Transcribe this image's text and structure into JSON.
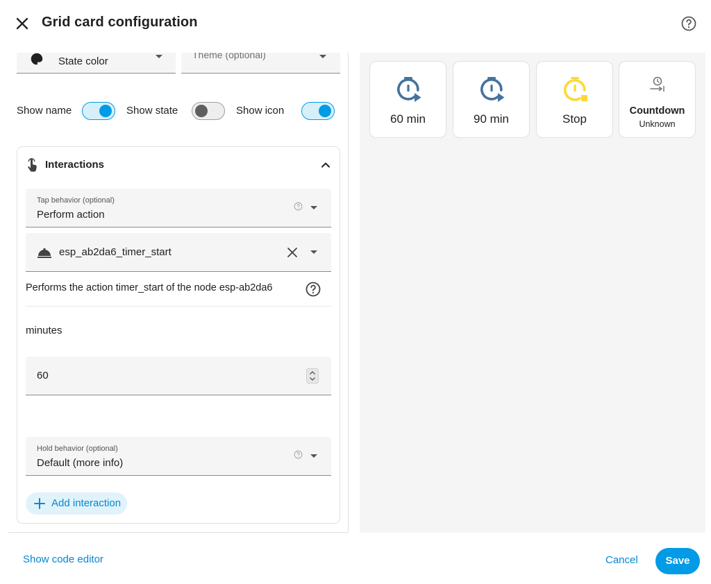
{
  "dialog": {
    "title": "Grid card configuration",
    "close_icon": "close-icon",
    "help_icon": "help-circle-icon"
  },
  "editor": {
    "state_color_label": "State color",
    "theme_placeholder": "Theme (optional)",
    "toggles": [
      {
        "label": "Show name",
        "on": true
      },
      {
        "label": "Show state",
        "on": false
      },
      {
        "label": "Show icon",
        "on": true
      }
    ],
    "interactions": {
      "title": "Interactions",
      "tap_label": "Tap behavior (optional)",
      "tap_value": "Perform action",
      "action_value": "esp_ab2da6_timer_start",
      "description": "Performs the action timer_start of the node esp-ab2da6",
      "minutes_label": "minutes",
      "minutes_value": "60",
      "hold_label": "Hold behavior (optional)",
      "hold_value": "Default (more info)",
      "add_label": "Add interaction"
    }
  },
  "preview": {
    "tiles": [
      {
        "name": "60 min",
        "icon": "timer-play-icon",
        "color": "#44739e"
      },
      {
        "name": "90 min",
        "icon": "timer-play-icon",
        "color": "#44739e"
      },
      {
        "name": "Stop",
        "icon": "timer-stop-icon",
        "color": "#fdd835"
      },
      {
        "name": "Countdown",
        "state": "Unknown",
        "icon": "timer-countdown-icon",
        "color": "#757575"
      }
    ]
  },
  "footer": {
    "code_editor": "Show code editor",
    "cancel": "Cancel",
    "save": "Save"
  },
  "colors": {
    "accent": "#039be5",
    "link": "#0288d1",
    "timer_blue": "#44739e",
    "timer_yellow": "#fdd835"
  }
}
